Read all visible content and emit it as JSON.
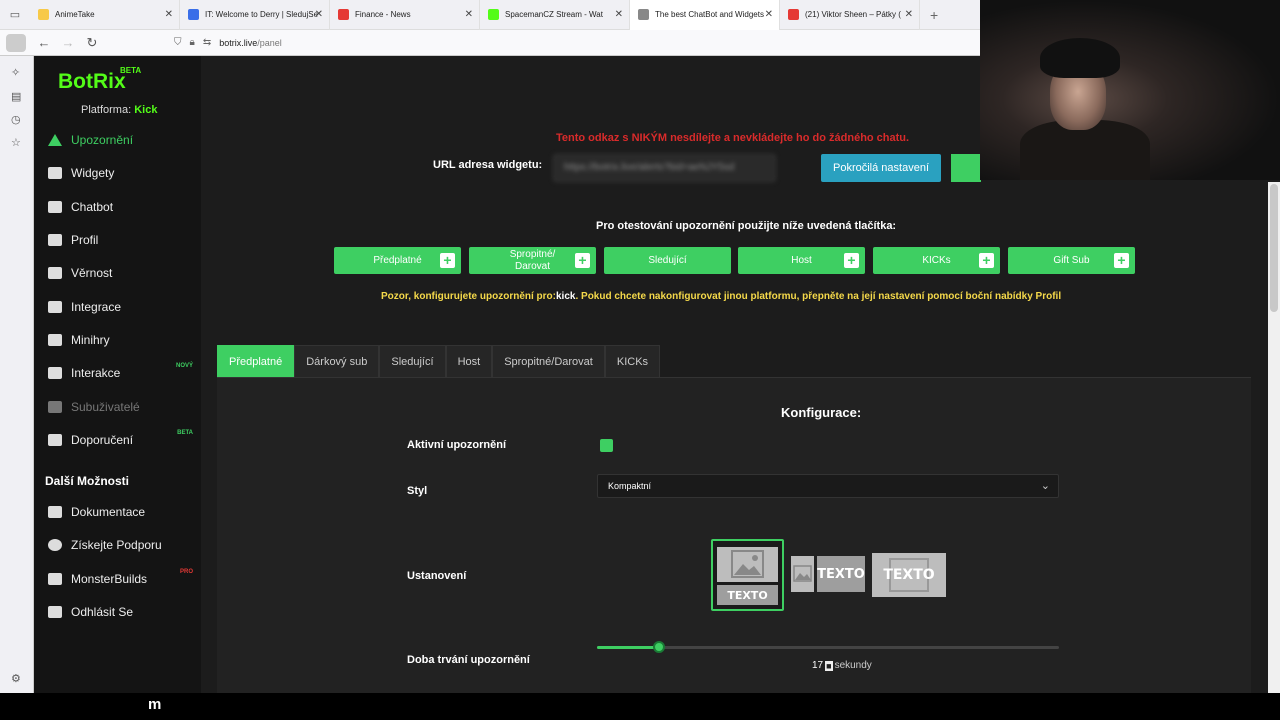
{
  "browser": {
    "tabs": [
      {
        "title": "AnimeTake",
        "fav": "#f7c948"
      },
      {
        "title": "IT: Welcome to Derry | SledujSe",
        "fav": "#3a6ee8"
      },
      {
        "title": "Finance - News",
        "fav": "#e53935"
      },
      {
        "title": "SpacemanCZ Stream - Wat",
        "fav": "#53fc18"
      },
      {
        "title": "The best ChatBot and Widgets",
        "fav": "#888888"
      },
      {
        "title": "(21) Viktor Sheen – Pátky (",
        "fav": "#e53935"
      }
    ],
    "url_host": "botrix.live",
    "url_path": "/panel"
  },
  "sidebar": {
    "brand": "BotRix",
    "brand_badge": "BETA",
    "platform_label": "Platforma:",
    "platform_value": "Kick",
    "items": [
      {
        "label": "Upozornění"
      },
      {
        "label": "Widgety"
      },
      {
        "label": "Chatbot"
      },
      {
        "label": "Profil"
      },
      {
        "label": "Věrnost"
      },
      {
        "label": "Integrace"
      },
      {
        "label": "Minihry"
      },
      {
        "label": "Interakce",
        "badge": "NOVÝ"
      },
      {
        "label": "Subuživatelé"
      },
      {
        "label": "Doporučení",
        "badge": "BETA"
      }
    ],
    "section_title": "Další Možnosti",
    "more_items": [
      {
        "label": "Dokumentace"
      },
      {
        "label": "Získejte Podporu"
      },
      {
        "label": "MonsterBuilds",
        "badge": "PRO"
      },
      {
        "label": "Odhlásit Se"
      }
    ]
  },
  "content": {
    "warning_red": "Tento odkaz s NIKÝM nesdílejte a nevkládejte ho do žádného chatu.",
    "url_label": "URL adresa widgetu:",
    "url_value": "https://botrix.live/alerts?bid=aeNJY5sd",
    "advanced_button": "Pokročilá nastavení",
    "test_label": "Pro otestování upozornění použijte níže uvedená tlačítka:",
    "test_buttons": [
      {
        "label": "Předplatné",
        "plus": true
      },
      {
        "label": "Spropitné/ Darovat",
        "plus": true
      },
      {
        "label": "Sledující",
        "plus": false
      },
      {
        "label": "Host",
        "plus": true
      },
      {
        "label": "KICKs",
        "plus": true
      },
      {
        "label": "Gift Sub",
        "plus": true
      }
    ],
    "note_prefix": "Pozor, konfigurujete upozornění pro:",
    "note_platform": "kick",
    "note_suffix": ". Pokud chcete nakonfigurovat jinou platformu, přepněte na její nastavení pomocí boční nabídky Profil",
    "tabs": [
      "Předplatné",
      "Dárkový sub",
      "Sledující",
      "Host",
      "Spropitné/Darovat",
      "KICKs"
    ],
    "active_tab": 0,
    "config_title": "Konfigurace:",
    "active_label": "Aktivní upozornění",
    "active_checked": true,
    "style_label": "Styl",
    "style_value": "Kompaktní",
    "layout_label": "Ustanovení",
    "layout_text": "TEXTO",
    "duration_label": "Doba trvání upozornění",
    "duration_value": "17",
    "duration_unit": "sekundy",
    "duration_fraction": 0.135
  },
  "colors": {
    "accent": "#3ecf62",
    "kick_green": "#53fc18",
    "advanced_button": "#2aa1c0",
    "warning_red": "#d92b2b",
    "note_yellow": "#f5d94a"
  },
  "taskbar": {
    "label": "m"
  }
}
